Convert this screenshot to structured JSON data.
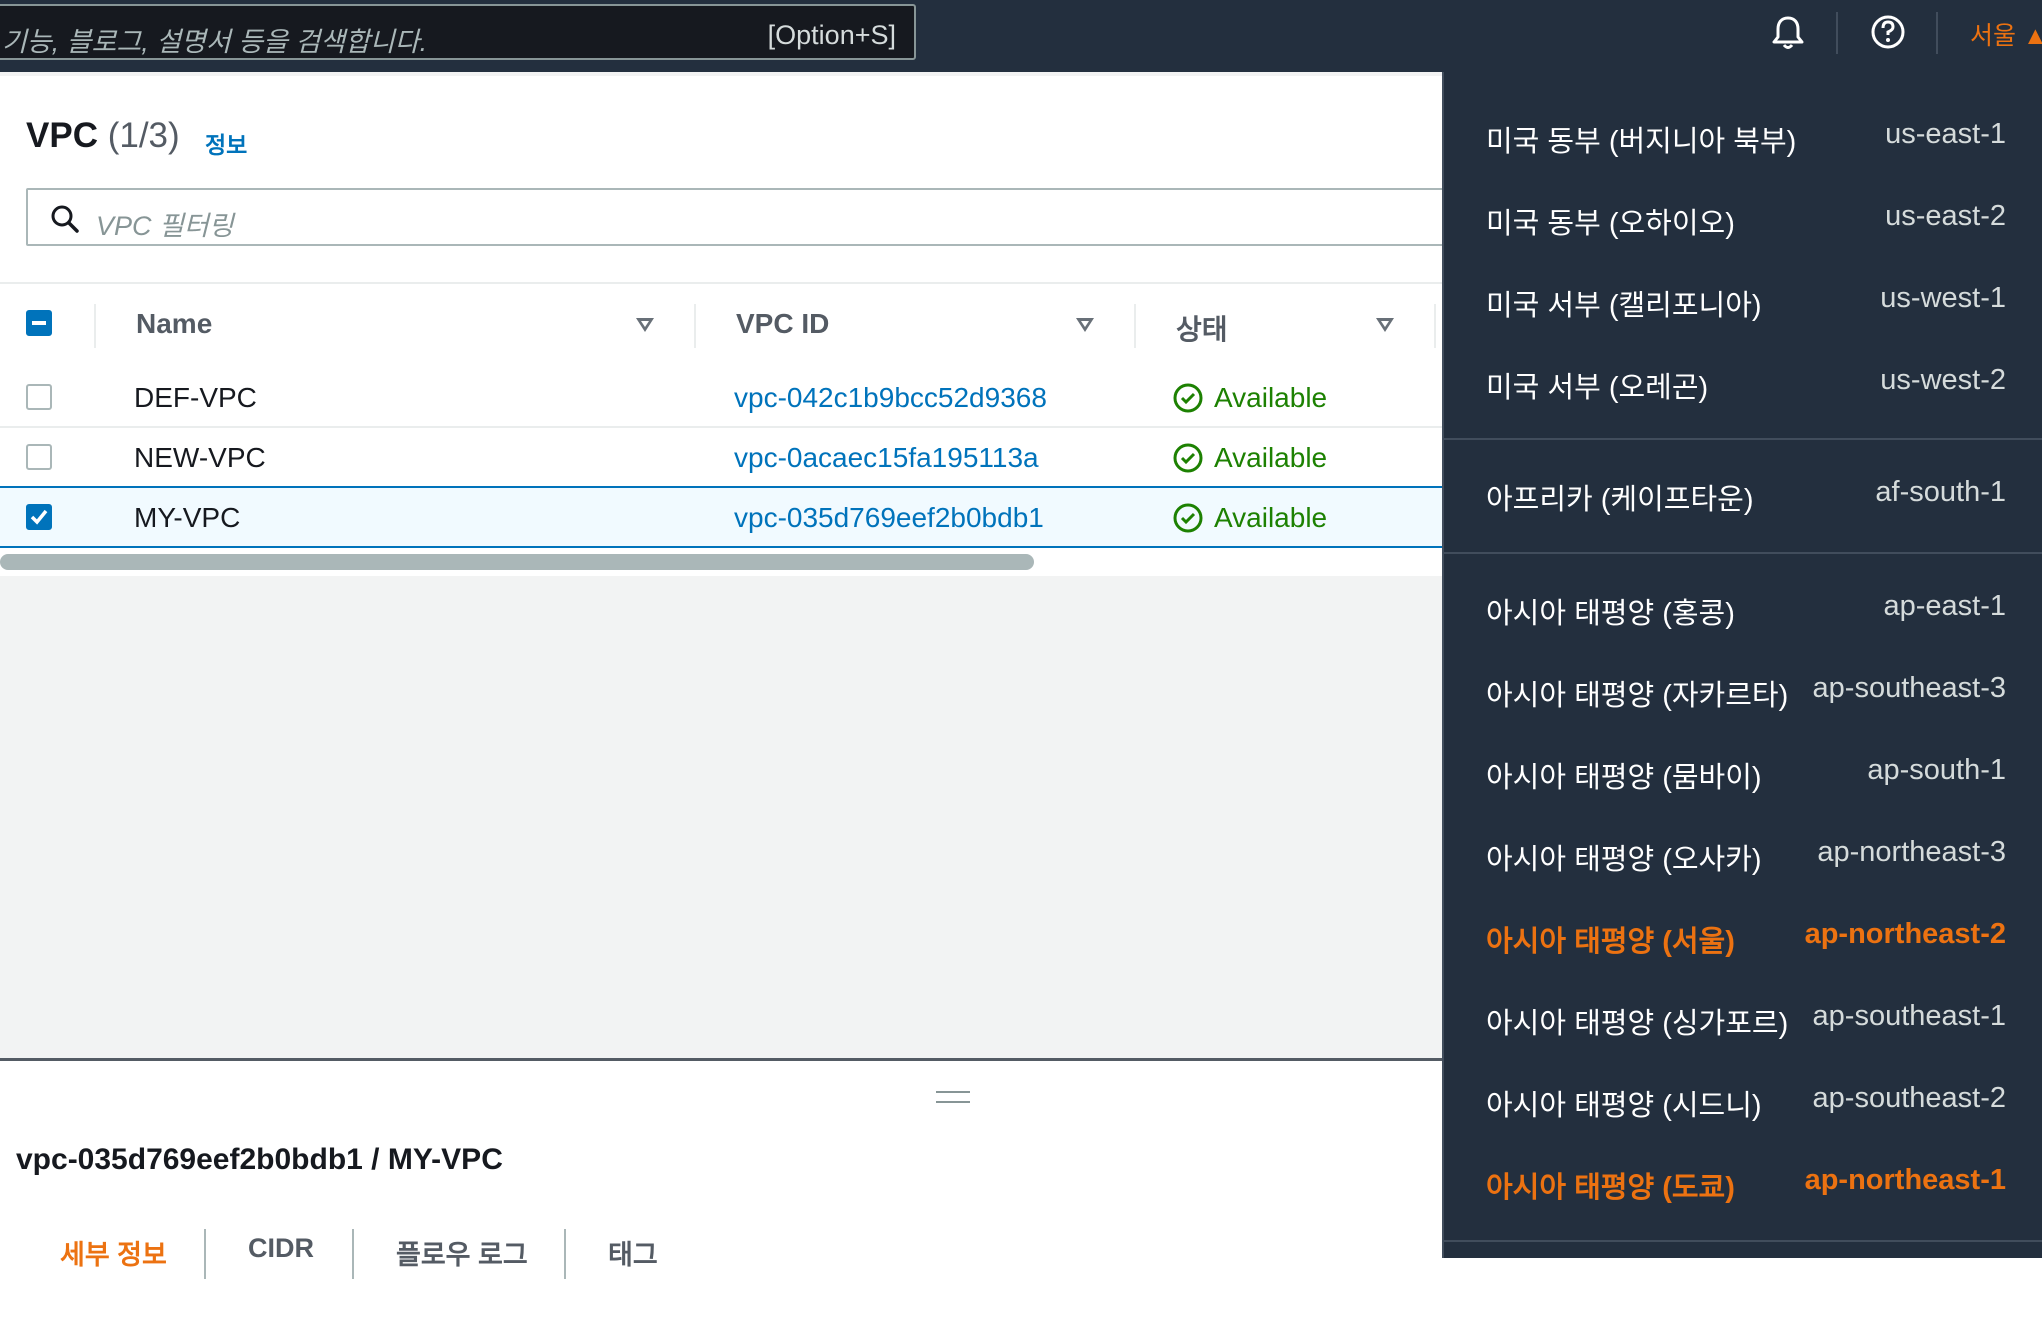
{
  "topbar": {
    "search_placeholder": "기능, 블로그, 설명서 등을 검색합니다.",
    "search_shortcut": "[Option+S]",
    "region_label": "서울 ▲",
    "icons": [
      "bell-icon",
      "help-icon"
    ]
  },
  "vpc_list": {
    "title": "VPC",
    "count": "(1/3)",
    "info_link": "정보",
    "filter_placeholder": "VPC 필터링",
    "columns": [
      "Name",
      "VPC ID",
      "상태"
    ],
    "rows": [
      {
        "name": "DEF-VPC",
        "vpc_id": "vpc-042c1b9bcc52d9368",
        "status": "Available",
        "selected": false
      },
      {
        "name": "NEW-VPC",
        "vpc_id": "vpc-0acaec15fa195113a",
        "status": "Available",
        "selected": false
      },
      {
        "name": "MY-VPC",
        "vpc_id": "vpc-035d769eef2b0bdb1",
        "status": "Available",
        "selected": true
      }
    ]
  },
  "detail": {
    "title": "vpc-035d769eef2b0bdb1 / MY-VPC",
    "tabs": [
      "세부 정보",
      "CIDR",
      "플로우 로그",
      "태그"
    ],
    "active_tab": "세부 정보"
  },
  "region_menu": {
    "groups": [
      [
        {
          "name": "미국 동부 (버지니아 북부)",
          "code": "us-east-1"
        },
        {
          "name": "미국 동부 (오하이오)",
          "code": "us-east-2"
        },
        {
          "name": "미국 서부 (캘리포니아)",
          "code": "us-west-1"
        },
        {
          "name": "미국 서부 (오레곤)",
          "code": "us-west-2"
        }
      ],
      [
        {
          "name": "아프리카 (케이프타운)",
          "code": "af-south-1"
        }
      ],
      [
        {
          "name": "아시아 태평양 (홍콩)",
          "code": "ap-east-1"
        },
        {
          "name": "아시아 태평양 (자카르타)",
          "code": "ap-southeast-3"
        },
        {
          "name": "아시아 태평양 (뭄바이)",
          "code": "ap-south-1"
        },
        {
          "name": "아시아 태평양 (오사카)",
          "code": "ap-northeast-3"
        },
        {
          "name": "아시아 태평양 (서울)",
          "code": "ap-northeast-2",
          "highlighted": true
        },
        {
          "name": "아시아 태평양 (싱가포르)",
          "code": "ap-southeast-1"
        },
        {
          "name": "아시아 태평양 (시드니)",
          "code": "ap-southeast-2"
        },
        {
          "name": "아시아 태평양 (도쿄)",
          "code": "ap-northeast-1",
          "highlighted": true
        }
      ]
    ]
  },
  "colors": {
    "topbar_bg": "#232f3e",
    "accent_orange": "#ec7211",
    "link_blue": "#0073bb",
    "status_green": "#1d8102"
  }
}
